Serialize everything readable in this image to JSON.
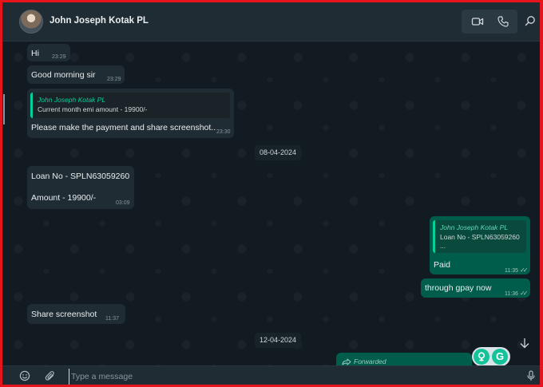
{
  "header": {
    "contact_name": "John Joseph Kotak PL",
    "icons": [
      "avatar",
      "video-call-icon",
      "voice-call-icon",
      "search-icon"
    ]
  },
  "messages": {
    "m1": {
      "text": "Hi",
      "time": "23:29"
    },
    "m2": {
      "text": "Good morning sir",
      "time": "23:29"
    },
    "m3": {
      "quote_author": "John Joseph Kotak PL",
      "quote_text": "Current month emi amount - 19900/-",
      "text": "Please make the payment and share screenshot..",
      "time": "23:30"
    },
    "date1": "08-04-2024",
    "m4": {
      "line1": "Loan No - SPLN63059260",
      "line2": "Amount - 19900/-",
      "time": "03:09"
    },
    "m5": {
      "quote_author": "John Joseph Kotak PL",
      "quote_line1": "Loan No - SPLN63059260",
      "quote_line2": "...",
      "text": "Paid",
      "time": "11:35"
    },
    "m6": {
      "text": "through gpay now",
      "time": "11:36"
    },
    "m7": {
      "text": "Share screenshot",
      "time": "11:37"
    },
    "date2": "12-04-2024",
    "forwarded": {
      "label": "Forwarded"
    }
  },
  "composer": {
    "placeholder": "Type a message",
    "icons": [
      "emoji-icon",
      "attach-icon",
      "mic-icon"
    ]
  },
  "colors": {
    "background": "#111b21",
    "incoming_bubble": "#202c33",
    "outgoing_bubble": "#005c4b",
    "accent": "#06cf9c",
    "frame": "#e8141c"
  }
}
